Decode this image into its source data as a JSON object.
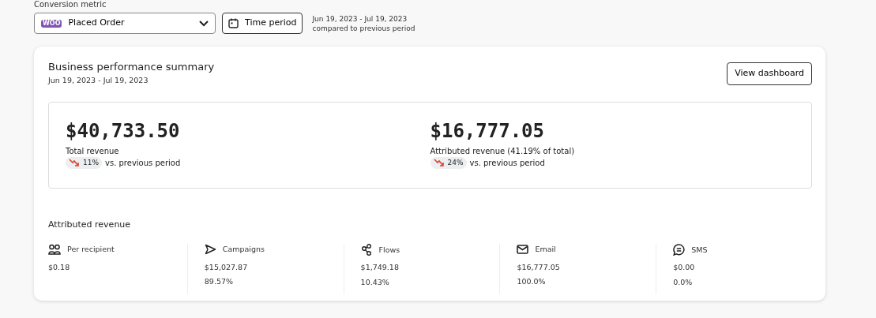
{
  "filters": {
    "metric_label": "Conversion metric",
    "metric": {
      "value": "Placed Order",
      "badge": "WOO"
    },
    "time_button": "Time period",
    "date_range": "Jun 19, 2023 - Jul 19, 2023",
    "comparison": "compared to previous period"
  },
  "summary": {
    "title": "Business performance summary",
    "subtitle": "Jun 19, 2023 - Jul 19, 2023",
    "action": "View dashboard",
    "metrics": [
      {
        "value": "$40,733.50",
        "label": "Total revenue",
        "change": {
          "kind": "down",
          "percent": "11%"
        },
        "comparison": "vs. previous period"
      },
      {
        "value": "$16,777.05",
        "label": "Attributed revenue (41.19% of total)",
        "change": {
          "kind": "down",
          "percent": "24%"
        },
        "comparison": "vs. previous period"
      }
    ],
    "breakdown_title": "Attributed revenue",
    "breakdown": [
      {
        "kind": "recipient",
        "label": "Per recipient",
        "amount": "$0.18"
      },
      {
        "kind": "campaigns",
        "label": "Campaigns",
        "amount": "$15,027.87",
        "share": "89.57%"
      },
      {
        "kind": "flows",
        "label": "Flows",
        "amount": "$1,749.18",
        "share": "10.43%"
      },
      {
        "kind": "email",
        "label": "Email",
        "amount": "$16,777.05",
        "share": "100.0%"
      },
      {
        "kind": "sms",
        "label": "SMS",
        "amount": "$0.00",
        "share": "0.0%"
      }
    ]
  }
}
